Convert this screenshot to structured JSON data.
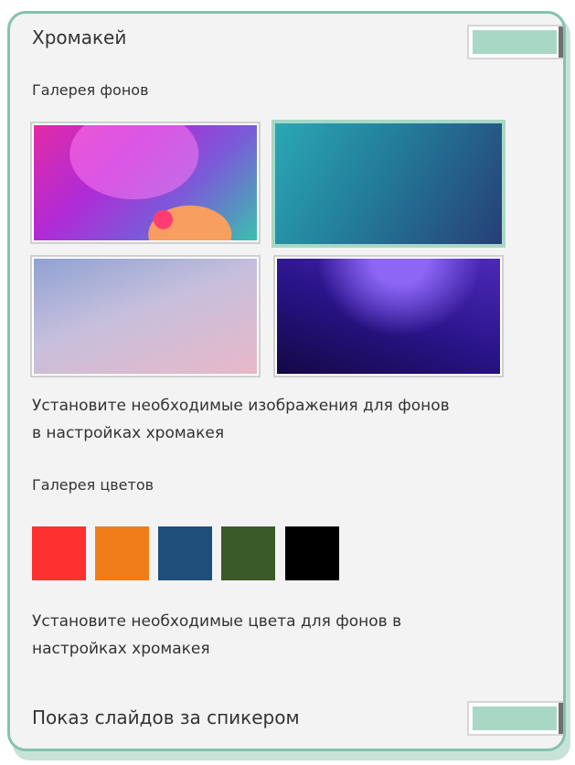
{
  "chromakey": {
    "title": "Хромакей",
    "enabled": true,
    "backgrounds_heading": "Галерея фонов",
    "backgrounds": [
      {
        "name": "pink-purple-abstract",
        "selected": false
      },
      {
        "name": "teal-blue-gradient",
        "selected": true
      },
      {
        "name": "lavender-pink-gradient",
        "selected": false
      },
      {
        "name": "deep-purple-wave",
        "selected": false
      }
    ],
    "backgrounds_help": [
      "Установите необходимые изображения для фонов",
      "в настройках хромакея"
    ],
    "colors_heading": "Галерея цветов",
    "colors": [
      "#ff3030",
      "#f07d1a",
      "#1f4e7a",
      "#3b5a2a",
      "#000000"
    ],
    "colors_help": [
      "Установите необходимые цвета для фонов в",
      "настройках хромакея"
    ]
  },
  "slideshow": {
    "title": "Показ слайдов за спикером",
    "enabled": true
  },
  "theme": {
    "accent": "#84c4ac",
    "toggle_fill": "#a8d8c5",
    "knob": "#6f6f6f"
  }
}
